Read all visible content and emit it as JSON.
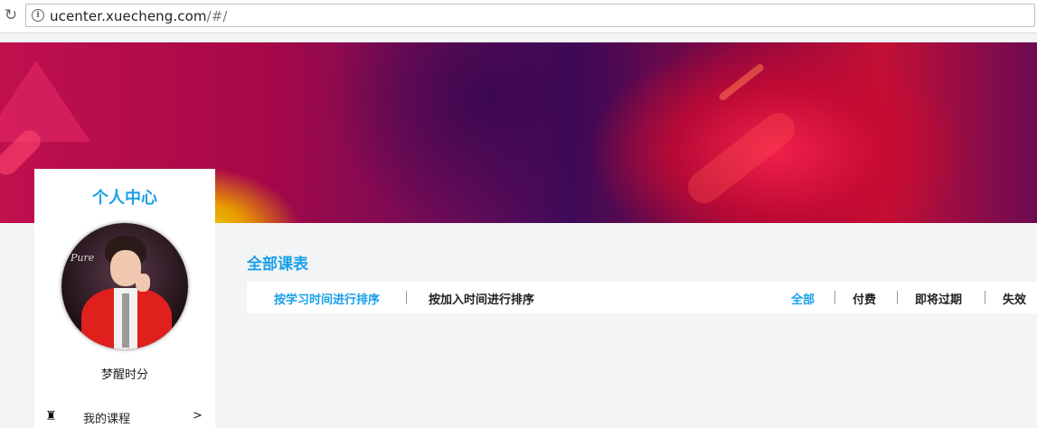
{
  "browser": {
    "url_host": "ucenter.xuecheng.com",
    "url_path": "/#/"
  },
  "sidebar": {
    "title": "个人中心",
    "avatar_caption": "Pure",
    "username": "梦醒时分",
    "menu": [
      {
        "label": "我的课程",
        "icon": "rook-icon",
        "arrow": ">"
      }
    ]
  },
  "main": {
    "section_title": "全部课表",
    "sort_options": [
      {
        "label": "按学习时间进行排序",
        "active": true
      },
      {
        "label": "按加入时间进行排序",
        "active": false
      }
    ],
    "filters": [
      {
        "label": "全部",
        "active": true
      },
      {
        "label": "付费",
        "active": false
      },
      {
        "label": "即将过期",
        "active": false
      },
      {
        "label": "失效",
        "active": false
      }
    ]
  },
  "colors": {
    "accent": "#1aa0e8",
    "page_bg": "#f3f4f5"
  }
}
